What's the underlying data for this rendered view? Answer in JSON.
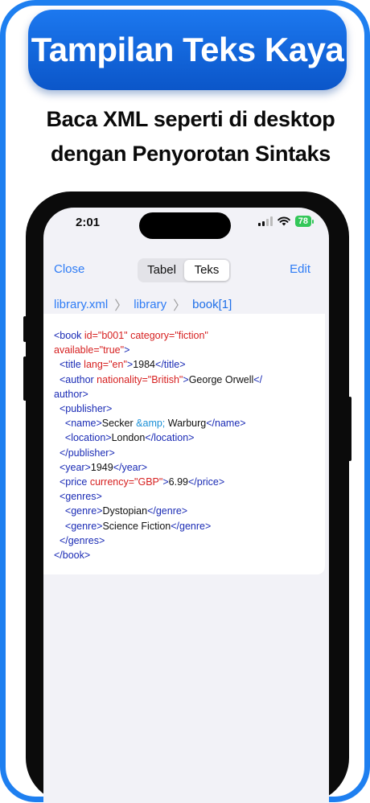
{
  "banner": {
    "title": "Tampilan Teks Kaya"
  },
  "subtitle": {
    "line1": "Baca XML seperti di desktop",
    "line2": "dengan Penyorotan Sintaks"
  },
  "status_bar": {
    "time": "2:01",
    "battery": "78"
  },
  "nav": {
    "close_label": "Close",
    "edit_label": "Edit",
    "segments": [
      "Tabel",
      "Teks"
    ],
    "selected_segment": "Teks"
  },
  "breadcrumb": [
    "library.xml",
    "library",
    "book[1]"
  ],
  "xml": {
    "lines": [
      [
        {
          "c": "t",
          "v": "<book "
        },
        {
          "c": "a",
          "v": "id=\"b001\" category=\"fiction\""
        }
      ],
      [
        {
          "c": "a",
          "v": "available=\"true\""
        },
        {
          "c": "t",
          "v": ">"
        }
      ],
      [
        {
          "c": "t",
          "v": "  <title "
        },
        {
          "c": "a",
          "v": "lang=\"en\""
        },
        {
          "c": "t",
          "v": ">"
        },
        {
          "c": "",
          "v": "1984"
        },
        {
          "c": "t",
          "v": "</title>"
        }
      ],
      [
        {
          "c": "t",
          "v": "  <author "
        },
        {
          "c": "a",
          "v": "nationality=\"British\""
        },
        {
          "c": "t",
          "v": ">"
        },
        {
          "c": "",
          "v": "George Orwell"
        },
        {
          "c": "t",
          "v": "</"
        }
      ],
      [
        {
          "c": "t",
          "v": "author>"
        }
      ],
      [
        {
          "c": "t",
          "v": "  <publisher>"
        }
      ],
      [
        {
          "c": "t",
          "v": "    <name>"
        },
        {
          "c": "",
          "v": "Secker "
        },
        {
          "c": "e",
          "v": "&amp;"
        },
        {
          "c": "",
          "v": " Warburg"
        },
        {
          "c": "t",
          "v": "</name>"
        }
      ],
      [
        {
          "c": "t",
          "v": "    <location>"
        },
        {
          "c": "",
          "v": "London"
        },
        {
          "c": "t",
          "v": "</location>"
        }
      ],
      [
        {
          "c": "t",
          "v": "  </publisher>"
        }
      ],
      [
        {
          "c": "t",
          "v": "  <year>"
        },
        {
          "c": "",
          "v": "1949"
        },
        {
          "c": "t",
          "v": "</year>"
        }
      ],
      [
        {
          "c": "t",
          "v": "  <price "
        },
        {
          "c": "a",
          "v": "currency=\"GBP\""
        },
        {
          "c": "t",
          "v": ">"
        },
        {
          "c": "",
          "v": "6.99"
        },
        {
          "c": "t",
          "v": "</price>"
        }
      ],
      [
        {
          "c": "t",
          "v": "  <genres>"
        }
      ],
      [
        {
          "c": "t",
          "v": "    <genre>"
        },
        {
          "c": "",
          "v": "Dystopian"
        },
        {
          "c": "t",
          "v": "</genre>"
        }
      ],
      [
        {
          "c": "t",
          "v": "    <genre>"
        },
        {
          "c": "",
          "v": "Science Fiction"
        },
        {
          "c": "t",
          "v": "</genre>"
        }
      ],
      [
        {
          "c": "t",
          "v": "  </genres>"
        }
      ],
      [
        {
          "c": "t",
          "v": "</book>"
        }
      ]
    ]
  },
  "colors": {
    "accent": "#2e7cf6",
    "banner": "#0b56c9",
    "tag": "#1a2bb5",
    "attr": "#d61f1f",
    "entity": "#1a8fd6",
    "battery": "#34c759"
  },
  "icons": [
    "signal-icon",
    "wifi-icon",
    "battery-icon",
    "chevron-right-icon"
  ]
}
